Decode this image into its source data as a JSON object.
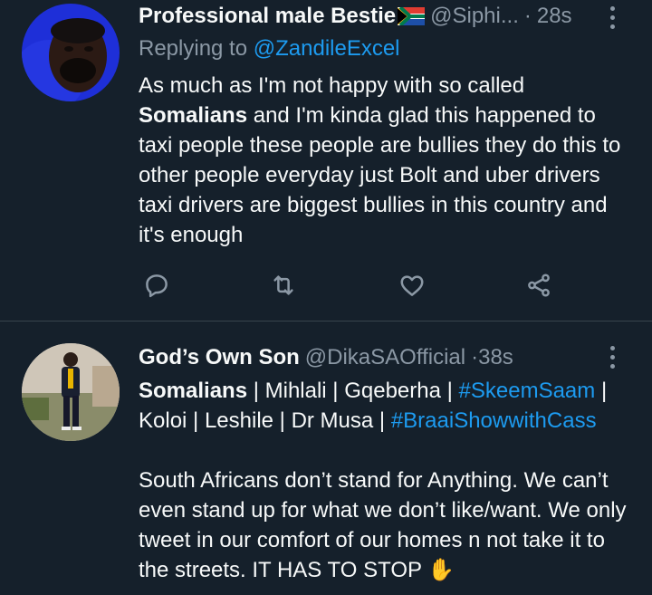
{
  "tweets": [
    {
      "display_name": "Professional male Bestie",
      "handle": "@Siphi...",
      "time": "28s",
      "replying_prefix": "Replying to ",
      "replying_to": "@ZandileExcel",
      "text_bold": "Somalians",
      "text_before": "As much as I'm not happy with so called",
      "text_after": "and I'm kinda glad this happened to taxi people these people are bullies they do this to other people everyday just Bolt and uber drivers taxi drivers are biggest bullies in this country and it's enough",
      "icons": [
        "reply-icon",
        "retweet-icon",
        "like-icon",
        "share-icon"
      ]
    },
    {
      "display_name": "God’s Own Son",
      "handle": "@DikaSAOfficial",
      "time": "38s",
      "line1_bold": "Somalians",
      "line1_rest": " | Mihlali | Gqeberha | ",
      "hashtag1": "#SkeemSaam",
      "pipe": " |",
      "line2_start": "Koloi | Leshile | Dr Musa | ",
      "hashtag2": "#BraaiShowwithCass",
      "paragraph": "South Africans don’t stand for Anything. We can’t even stand up for what we don’t like/want. We only tweet in our comfort of our homes n not take it to the streets. IT HAS TO STOP",
      "emoji": "✋"
    }
  ],
  "colors": {
    "background": "#15202b",
    "text": "#f7f9f9",
    "muted": "#8b98a5",
    "link": "#1d9bf0",
    "divider": "#38444d"
  }
}
